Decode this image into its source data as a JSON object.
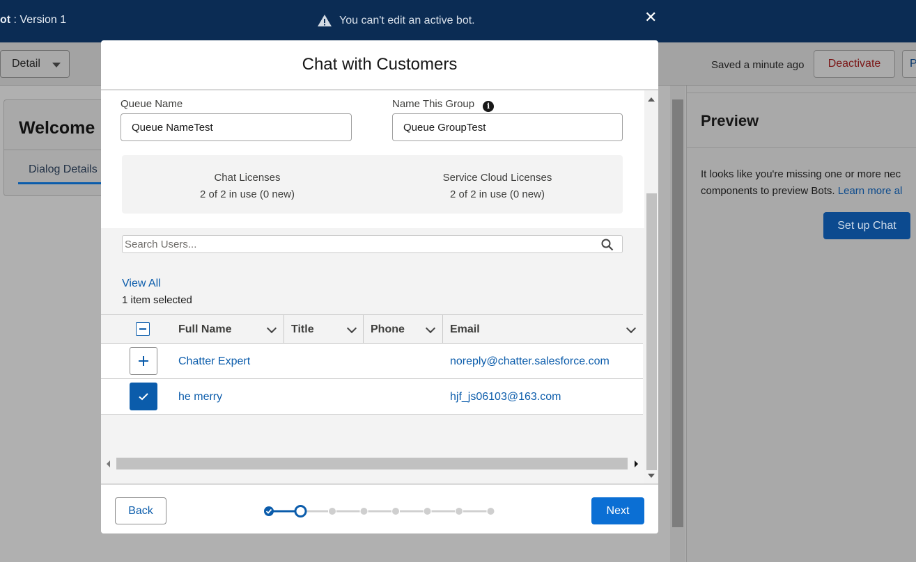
{
  "app": {
    "bot_version_prefix": "ot",
    "bot_version_suffix": " : Version 1",
    "warning": "You can't edit an active bot."
  },
  "toolbar": {
    "view_select": "Detail",
    "saved_status": "Saved a minute ago",
    "deactivate_label": "Deactivate",
    "extra_label": "P"
  },
  "welcome": {
    "title": "Welcome",
    "tab": "Dialog Details"
  },
  "preview": {
    "title": "Preview",
    "text_line1": "It looks like you're missing one or more nec",
    "text_line2": "components to preview Bots.",
    "learn_more": "Learn more al",
    "setup_label": "Set up Chat"
  },
  "modal": {
    "title": "Chat with Customers",
    "queue_name_label": "Queue Name",
    "queue_name_value": "Queue NameTest",
    "group_name_label": "Name This Group",
    "group_name_value": "Queue GroupTest",
    "licenses": [
      {
        "name": "Chat Licenses",
        "usage": "2 of 2 in use (0 new)"
      },
      {
        "name": "Service Cloud Licenses",
        "usage": "2 of 2 in use (0 new)"
      }
    ],
    "search_placeholder": "Search Users...",
    "view_all": "View All",
    "selected_count": "1 item selected",
    "columns": [
      "Full Name",
      "Title",
      "Phone",
      "Email"
    ],
    "rows": [
      {
        "full_name": "Chatter Expert",
        "title": "",
        "phone": "",
        "email": "noreply@chatter.salesforce.com",
        "selected": false
      },
      {
        "full_name": "he merry",
        "title": "",
        "phone": "",
        "email": "hjf_js06103@163.com",
        "selected": true
      }
    ],
    "back_label": "Back",
    "next_label": "Next",
    "stepper": {
      "total_steps": 8,
      "current_step": 2
    }
  },
  "colors": {
    "brand_blue": "#0b5cab",
    "header_navy": "#0b2c54",
    "button_blue": "#0b6fd4"
  }
}
